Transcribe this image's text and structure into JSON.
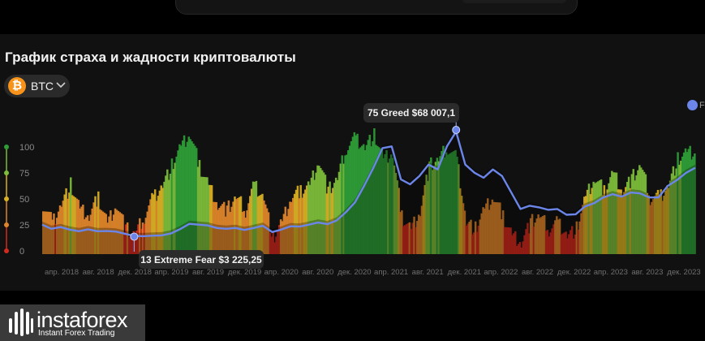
{
  "title": "График страха и жадности криптовалюты",
  "coin_selector": {
    "label": "BTC",
    "icon": "bitcoin-icon",
    "chevron": "chevron-down-icon"
  },
  "legend": {
    "label": "F"
  },
  "watermark": {
    "brand": "instaforex",
    "tagline": "Instant Forex Trading"
  },
  "colors": {
    "background": "#000000",
    "panel": "#111111",
    "price_line": "#6b86e8",
    "extreme_fear": "#d22a1e",
    "fear": "#e0862a",
    "neutral": "#d9b124",
    "greed": "#7dbd3a",
    "extreme_greed": "#2f9e37"
  },
  "chart_data": {
    "type": "bar",
    "title": "График страха и жадности криптовалюты",
    "y_axis_labels": [
      "100",
      "75",
      "50",
      "25",
      "0"
    ],
    "y_axis_values": [
      100,
      75,
      50,
      25,
      0
    ],
    "ylim": [
      0,
      100
    ],
    "x_tick_labels": [
      "апр. 2018",
      "авг. 2018",
      "дек. 2018",
      "апр. 2019",
      "авг. 2019",
      "дек. 2019",
      "апр. 2020",
      "авг. 2020",
      "дек. 2020",
      "апр. 2021",
      "авг. 2021",
      "дек. 2021",
      "апр. 2022",
      "авг. 2022",
      "дек. 2022",
      "апр. 2023",
      "авг. 2023",
      "дек. 2023"
    ],
    "x_range": [
      "2018-02",
      "2024-01"
    ],
    "grid": false,
    "legend_position": "top-right",
    "series": [
      {
        "kind": "fear_greed_index_bars",
        "x": [
          "2018-02",
          "2018-03",
          "2018-04",
          "2018-05",
          "2018-06",
          "2018-07",
          "2018-08",
          "2018-09",
          "2018-10",
          "2018-11",
          "2018-12",
          "2019-01",
          "2019-02",
          "2019-03",
          "2019-04",
          "2019-05",
          "2019-06",
          "2019-07",
          "2019-08",
          "2019-09",
          "2019-10",
          "2019-11",
          "2019-12",
          "2020-01",
          "2020-02",
          "2020-03",
          "2020-04",
          "2020-05",
          "2020-06",
          "2020-07",
          "2020-08",
          "2020-09",
          "2020-10",
          "2020-11",
          "2020-12",
          "2021-01",
          "2021-02",
          "2021-03",
          "2021-04",
          "2021-05",
          "2021-06",
          "2021-07",
          "2021-08",
          "2021-09",
          "2021-10",
          "2021-11",
          "2021-12",
          "2022-01",
          "2022-02",
          "2022-03",
          "2022-04",
          "2022-05",
          "2022-06",
          "2022-07",
          "2022-08",
          "2022-09",
          "2022-10",
          "2022-11",
          "2022-12",
          "2023-01",
          "2023-02",
          "2023-03",
          "2023-04",
          "2023-05",
          "2023-06",
          "2023-07",
          "2023-08",
          "2023-09",
          "2023-10",
          "2023-11",
          "2023-12",
          "2024-01"
        ],
        "values": [
          40,
          25,
          40,
          55,
          35,
          30,
          45,
          25,
          40,
          20,
          15,
          30,
          45,
          55,
          70,
          85,
          95,
          70,
          55,
          40,
          35,
          45,
          35,
          55,
          45,
          12,
          25,
          45,
          50,
          55,
          75,
          50,
          60,
          85,
          92,
          85,
          95,
          75,
          80,
          30,
          20,
          35,
          70,
          75,
          85,
          75,
          25,
          20,
          35,
          45,
          30,
          15,
          10,
          25,
          30,
          20,
          25,
          15,
          20,
          45,
          60,
          50,
          65,
          50,
          60,
          70,
          45,
          45,
          55,
          75,
          80,
          80
        ]
      },
      {
        "kind": "price_line",
        "x": [
          "2018-02",
          "2018-03",
          "2018-04",
          "2018-05",
          "2018-06",
          "2018-07",
          "2018-08",
          "2018-09",
          "2018-10",
          "2018-11",
          "2018-12",
          "2019-01",
          "2019-02",
          "2019-03",
          "2019-04",
          "2019-05",
          "2019-06",
          "2019-07",
          "2019-08",
          "2019-09",
          "2019-10",
          "2019-11",
          "2019-12",
          "2020-01",
          "2020-02",
          "2020-03",
          "2020-04",
          "2020-05",
          "2020-06",
          "2020-07",
          "2020-08",
          "2020-09",
          "2020-10",
          "2020-11",
          "2020-12",
          "2021-01",
          "2021-02",
          "2021-03",
          "2021-04",
          "2021-05",
          "2021-06",
          "2021-07",
          "2021-08",
          "2021-09",
          "2021-10",
          "2021-11",
          "2021-12",
          "2022-01",
          "2022-02",
          "2022-03",
          "2022-04",
          "2022-05",
          "2022-06",
          "2022-07",
          "2022-08",
          "2022-09",
          "2022-10",
          "2022-11",
          "2022-12",
          "2023-01",
          "2023-02",
          "2023-03",
          "2023-04",
          "2023-05",
          "2023-06",
          "2023-07",
          "2023-08",
          "2023-09",
          "2023-10",
          "2023-11",
          "2023-12",
          "2024-01"
        ],
        "values": [
          10500,
          8000,
          9000,
          7500,
          6500,
          7700,
          6500,
          6600,
          6300,
          5000,
          3700,
          3500,
          3800,
          4000,
          5200,
          7800,
          11000,
          10500,
          10000,
          8500,
          8000,
          8500,
          7300,
          8500,
          9800,
          6000,
          7500,
          9500,
          9300,
          10500,
          11800,
          10800,
          13000,
          18000,
          24000,
          34000,
          45000,
          57000,
          58000,
          38000,
          35000,
          40000,
          47000,
          44000,
          58000,
          67000,
          47000,
          42000,
          39000,
          44000,
          40000,
          30000,
          20000,
          22000,
          21000,
          19500,
          20000,
          16500,
          16800,
          21500,
          23500,
          27000,
          29000,
          27500,
          30000,
          29500,
          27000,
          27000,
          34000,
          37500,
          42000,
          45000
        ]
      }
    ],
    "annotations": [
      {
        "date": "2021-11",
        "text": "75 Greed $68 007,1",
        "index": 75,
        "label": "Greed",
        "price": 68007.1
      },
      {
        "date": "2018-12",
        "text": "13 Extreme Fear $3 225,25",
        "index": 13,
        "label": "Extreme Fear",
        "price": 3225.25
      }
    ]
  }
}
